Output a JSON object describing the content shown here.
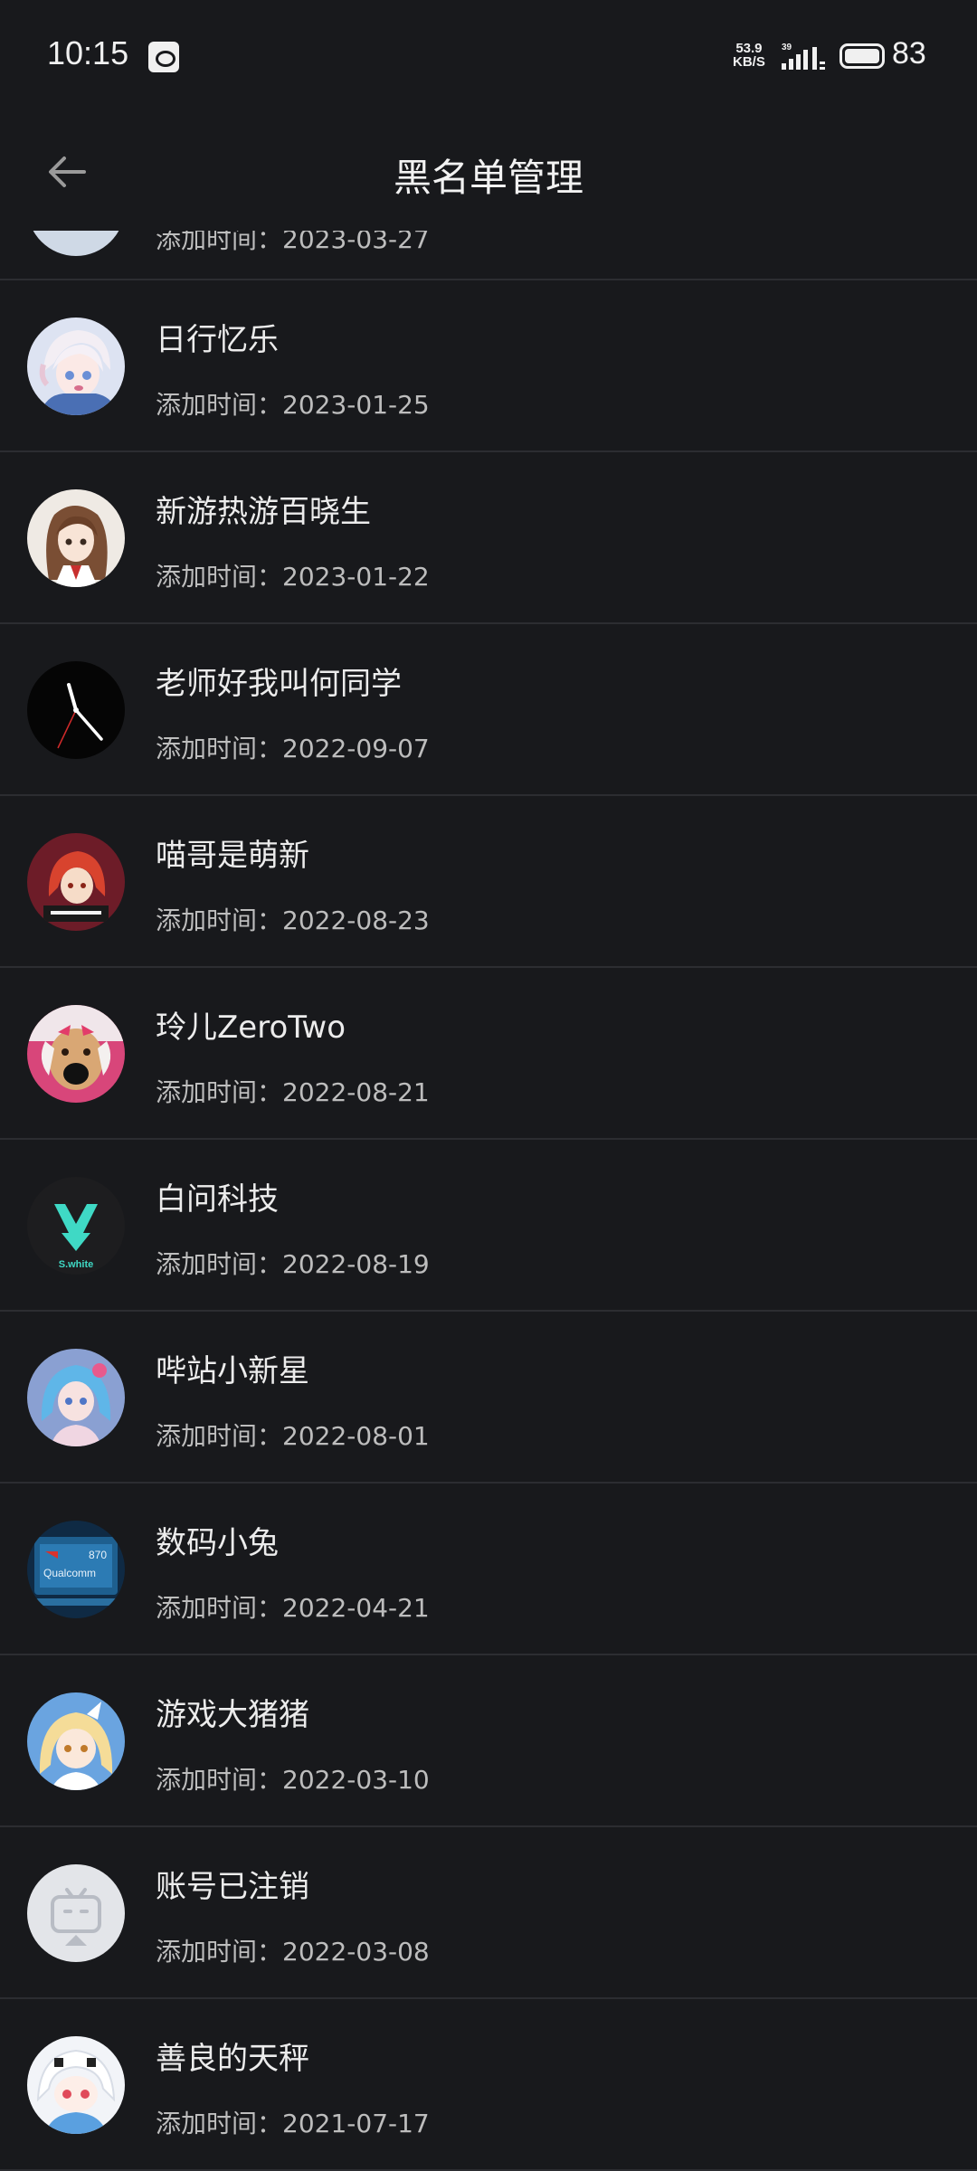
{
  "status_bar": {
    "time": "10:15",
    "net_speed_value": "53.9",
    "net_speed_unit": "KB/S",
    "network_type": "39",
    "battery": "83"
  },
  "header": {
    "title": "黑名单管理"
  },
  "date_label": "添加时间：",
  "partial_row": {
    "date": "2023-03-27"
  },
  "users": [
    {
      "name": "日行忆乐",
      "date": "2023-01-25",
      "avatar": "anime-girl-white-hair",
      "avatar_bg": "#d9dff0"
    },
    {
      "name": "新游热游百晓生",
      "date": "2023-01-22",
      "avatar": "anime-girl-brown-hair",
      "avatar_bg": "#efeae4"
    },
    {
      "name": "老师好我叫何同学",
      "date": "2022-09-07",
      "avatar": "clock-face",
      "avatar_bg": "#050505"
    },
    {
      "name": "喵哥是萌新",
      "date": "2022-08-23",
      "avatar": "anime-girl-red-hair",
      "avatar_bg": "#7a1f2b"
    },
    {
      "name": "玲儿ZeroTwo",
      "date": "2022-08-21",
      "avatar": "dog-pink",
      "avatar_bg": "#d8467a"
    },
    {
      "name": "白问科技",
      "date": "2022-08-19",
      "avatar": "swhite-logo",
      "avatar_bg": "#1c1c1c"
    },
    {
      "name": "哔站小新星",
      "date": "2022-08-01",
      "avatar": "anime-girl-blue-hair",
      "avatar_bg": "#8aa3d8"
    },
    {
      "name": "数码小兔",
      "date": "2022-04-21",
      "avatar": "qualcomm-chip",
      "avatar_bg": "#1f4d7a"
    },
    {
      "name": "游戏大猪猪",
      "date": "2022-03-10",
      "avatar": "anime-girl-blonde",
      "avatar_bg": "#6aa4e0"
    },
    {
      "name": "账号已注销",
      "date": "2022-03-08",
      "avatar": "bilibili-tv-default",
      "avatar_bg": "#e3e5e9"
    },
    {
      "name": "善良的天秤",
      "date": "2021-07-17",
      "avatar": "anime-chibi-white",
      "avatar_bg": "#f2f4f8"
    }
  ],
  "avatar_texts": {
    "swhite": "S.white",
    "qualcomm": "Qualcomm",
    "chip_num": "870"
  },
  "colors": {
    "background": "#18191c",
    "divider": "#2c2d31",
    "text_primary": "#ececec",
    "text_secondary": "#bdbdbd"
  }
}
